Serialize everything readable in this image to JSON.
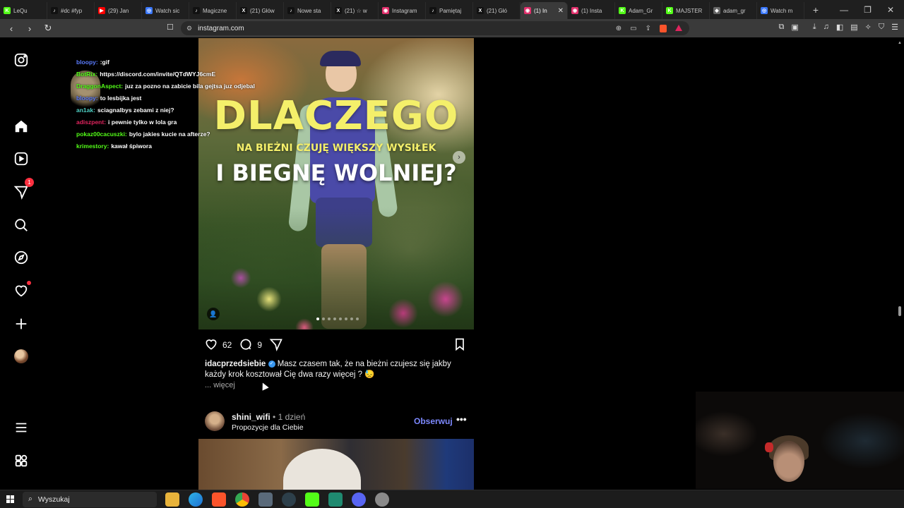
{
  "browser": {
    "tabs": [
      {
        "label": "LeQu",
        "fav_color": "#53fc18",
        "fav_char": "K"
      },
      {
        "label": "#dc #fyp",
        "fav_color": "#111111",
        "fav_char": "♪"
      },
      {
        "label": "(29) Jan",
        "fav_color": "#ff0000",
        "fav_char": "▶"
      },
      {
        "label": "Watch sic",
        "fav_color": "#3a78ff",
        "fav_char": "◎"
      },
      {
        "label": "Magiczne",
        "fav_color": "#111111",
        "fav_char": "♪"
      },
      {
        "label": "(21) Głów",
        "fav_color": "#111111",
        "fav_char": "X"
      },
      {
        "label": "Nowe sta",
        "fav_color": "#111111",
        "fav_char": "♪"
      },
      {
        "label": "(21) ☆ w",
        "fav_color": "#111111",
        "fav_char": "X"
      },
      {
        "label": "Instagram",
        "fav_color": "#e1306c",
        "fav_char": "◉"
      },
      {
        "label": "Pamiętaj",
        "fav_color": "#111111",
        "fav_char": "♪"
      },
      {
        "label": "(21) Głó",
        "fav_color": "#111111",
        "fav_char": "X"
      },
      {
        "label": "(1) In",
        "fav_color": "#e1306c",
        "fav_char": "◉",
        "active": true
      },
      {
        "label": "(1) Insta",
        "fav_color": "#e1306c",
        "fav_char": "◉"
      },
      {
        "label": "Adam_Gr",
        "fav_color": "#53fc18",
        "fav_char": "K"
      },
      {
        "label": "MAJSTER",
        "fav_color": "#53fc18",
        "fav_char": "K"
      },
      {
        "label": "adam_gr",
        "fav_color": "#666666",
        "fav_char": "◆"
      },
      {
        "label": "Watch m",
        "fav_color": "#3a78ff",
        "fav_char": "◎"
      }
    ],
    "new_tab": "+",
    "url": "instagram.com"
  },
  "chat": [
    {
      "user": "bloopy:",
      "user_color": "#5b7cff",
      "msg": ":gif"
    },
    {
      "user": "BotRix:",
      "user_color": "#53fc18",
      "msg": "https://discord.com/invite/QTdWYJ6cmE"
    },
    {
      "user": "DraggonAspect:",
      "user_color": "#53fc18",
      "msg": "juz za pozno na zabicie bila gejtsa juz odjebal"
    },
    {
      "user": "bloopy:",
      "user_color": "#5b7cff",
      "msg": "to lesbijka jest"
    },
    {
      "user": "an1ak:",
      "user_color": "#4fd1c5",
      "msg": "sciagnalbys zebami z niej?"
    },
    {
      "user": "adiszpent:",
      "user_color": "#e0245e",
      "msg": "i pewnie tylko w lola gra"
    },
    {
      "user": "pokaz00cacuszki:",
      "user_color": "#53fc18",
      "msg": "bylo jakies kucie na afterze?"
    },
    {
      "user": "krimestory:",
      "user_color": "#53fc18",
      "msg": "kawał śpiwora"
    }
  ],
  "post": {
    "image_text": {
      "line1": "DLACZEGO",
      "line2": "NA BIEŻNI CZUJĘ WIĘKSZY WYSIŁEK",
      "line3": "I BIEGNĘ WOLNIEJ?"
    },
    "carousel_total": 8,
    "carousel_index": 1,
    "likes": "62",
    "comments": "9",
    "author": "idacprzedsiebie",
    "caption": "Masz czasem tak, że na bieżni czujesz się jakby każdy krok kosztował Cię dwa razy więcej ? 😓",
    "more": "... więcej"
  },
  "next_post": {
    "author": "shini_wifi",
    "time": "• 1 dzień",
    "subtitle": "Propozycje dla Ciebie",
    "follow_label": "Obserwuj",
    "menu": "•••"
  },
  "rail": {
    "notifications_badge": "1"
  },
  "taskbar": {
    "search_placeholder": "Wyszukaj"
  },
  "colors": {
    "follow": "#7d89ff",
    "badge": "#ff3040",
    "verified": "#3897f0"
  }
}
